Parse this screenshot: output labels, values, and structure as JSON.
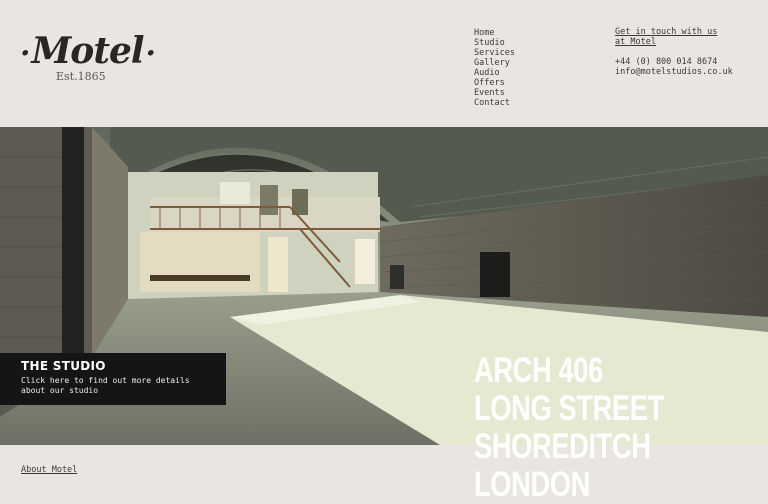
{
  "logo": {
    "word": "Motel",
    "est": "Est.1865"
  },
  "nav": {
    "items": [
      "Home",
      "Studio",
      "Services",
      "Gallery",
      "Audio",
      "Offers",
      "Events",
      "Contact"
    ]
  },
  "contact": {
    "cta": "Get in touch with us at Motel",
    "phone": "+44 (0) 800 014 8674",
    "email": "info@motelstudios.co.uk"
  },
  "studio_box": {
    "heading": "THE STUDIO",
    "text": "Click here to find out more details about our studio"
  },
  "address": {
    "lines": [
      "ARCH 406",
      "LONG STREET",
      "SHOREDITCH",
      "LONDON"
    ]
  },
  "footer": {
    "about": "About Motel"
  },
  "colors": {
    "background": "#e9e6e1",
    "overlay": "#151515",
    "text": "#3a3a3a"
  }
}
